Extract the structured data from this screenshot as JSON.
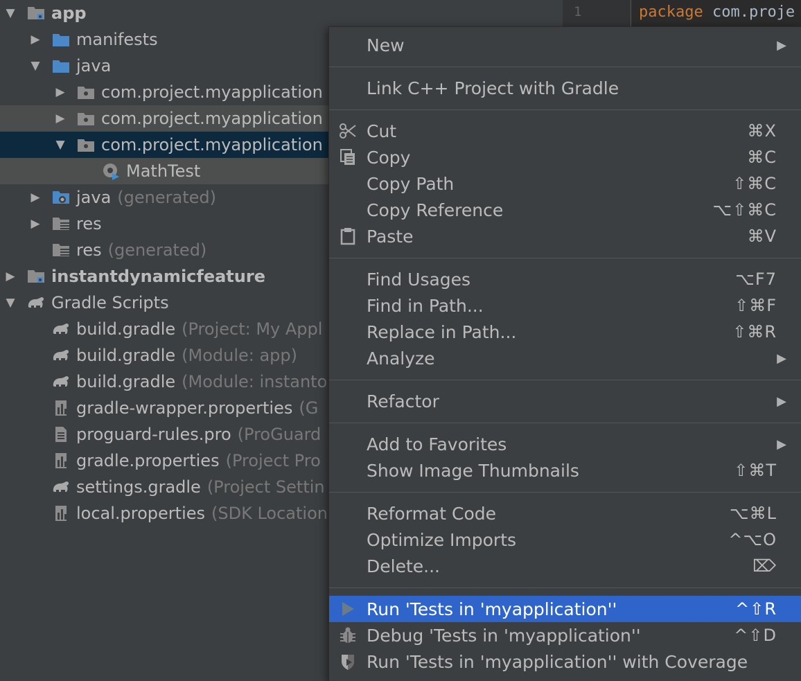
{
  "tree": {
    "rows": [
      {
        "arrow": "▼",
        "name": "app",
        "hint": "",
        "icon": "module-folder-icon"
      },
      {
        "arrow": "▶",
        "name": "manifests",
        "hint": "",
        "icon": "folder-icon"
      },
      {
        "arrow": "▼",
        "name": "java",
        "hint": "",
        "icon": "folder-icon"
      },
      {
        "arrow": "▶",
        "name": "com.project.myapplication",
        "hint": "",
        "icon": "package-icon"
      },
      {
        "arrow": "▶",
        "name": "com.project.myapplication",
        "hint": "",
        "icon": "package-icon"
      },
      {
        "arrow": "▼",
        "name": "com.project.myapplication",
        "hint": "",
        "icon": "package-icon"
      },
      {
        "arrow": "",
        "name": "MathTest",
        "hint": "",
        "icon": "test-class-icon"
      },
      {
        "arrow": "▶",
        "name": "java",
        "hint": "(generated)",
        "icon": "generated-folder-icon"
      },
      {
        "arrow": "▶",
        "name": "res",
        "hint": "",
        "icon": "resource-folder-icon"
      },
      {
        "arrow": "",
        "name": "res",
        "hint": "(generated)",
        "icon": "resource-folder-icon"
      },
      {
        "arrow": "▶",
        "name": "instantdynamicfeature",
        "hint": "",
        "icon": "module-folder-icon"
      },
      {
        "arrow": "▼",
        "name": "Gradle Scripts",
        "hint": "",
        "icon": "gradle-icon"
      },
      {
        "arrow": "",
        "name": "build.gradle",
        "hint": "(Project: My Appl",
        "icon": "gradle-icon"
      },
      {
        "arrow": "",
        "name": "build.gradle",
        "hint": "(Module: app)",
        "icon": "gradle-icon"
      },
      {
        "arrow": "",
        "name": "build.gradle",
        "hint": "(Module: instanto",
        "icon": "gradle-icon"
      },
      {
        "arrow": "",
        "name": "gradle-wrapper.properties",
        "hint": "(G",
        "icon": "properties-file-icon"
      },
      {
        "arrow": "",
        "name": "proguard-rules.pro",
        "hint": "(ProGuard",
        "icon": "text-file-icon"
      },
      {
        "arrow": "",
        "name": "gradle.properties",
        "hint": "(Project Pro",
        "icon": "properties-file-icon"
      },
      {
        "arrow": "",
        "name": "settings.gradle",
        "hint": "(Project Settin",
        "icon": "gradle-icon"
      },
      {
        "arrow": "",
        "name": "local.properties",
        "hint": "(SDK Location",
        "icon": "properties-file-icon"
      }
    ]
  },
  "editor": {
    "line_number": "1",
    "keyword": "package",
    "code": "com.proje"
  },
  "context_menu": {
    "new": {
      "label": "New"
    },
    "link_cpp": {
      "label": "Link C++ Project with Gradle"
    },
    "cut": {
      "label": "Cut",
      "shortcut": "⌘X"
    },
    "copy": {
      "label": "Copy",
      "shortcut": "⌘C"
    },
    "copy_path": {
      "label": "Copy Path",
      "shortcut": "⇧⌘C"
    },
    "copy_reference": {
      "label": "Copy Reference",
      "shortcut": "⌥⇧⌘C"
    },
    "paste": {
      "label": "Paste",
      "shortcut": "⌘V"
    },
    "find_usages": {
      "label": "Find Usages",
      "shortcut": "⌥F7"
    },
    "find_in_path": {
      "label": "Find in Path...",
      "shortcut": "⇧⌘F"
    },
    "replace_in_path": {
      "label": "Replace in Path...",
      "shortcut": "⇧⌘R"
    },
    "analyze": {
      "label": "Analyze"
    },
    "refactor": {
      "label": "Refactor"
    },
    "add_to_favorites": {
      "label": "Add to Favorites"
    },
    "show_image_thumbnails": {
      "label": "Show Image Thumbnails",
      "shortcut": "⇧⌘T"
    },
    "reformat_code": {
      "label": "Reformat Code",
      "shortcut": "⌥⌘L"
    },
    "optimize_imports": {
      "label": "Optimize Imports",
      "shortcut": "^⌥O"
    },
    "delete": {
      "label": "Delete...",
      "shortcut": "⌦"
    },
    "run_tests": {
      "label": "Run 'Tests in 'myapplication''",
      "shortcut": "^⇧R"
    },
    "debug_tests": {
      "label": "Debug 'Tests in 'myapplication''",
      "shortcut": "^⇧D"
    },
    "run_coverage": {
      "label": "Run 'Tests in 'myapplication'' with Coverage"
    }
  },
  "colors": {
    "panel_bg": "#3c3f41",
    "menu_highlight": "#2f65ca",
    "tree_selected": "#0d293e",
    "hint_gray": "#787878",
    "folder_blue": "#4a88c7"
  }
}
